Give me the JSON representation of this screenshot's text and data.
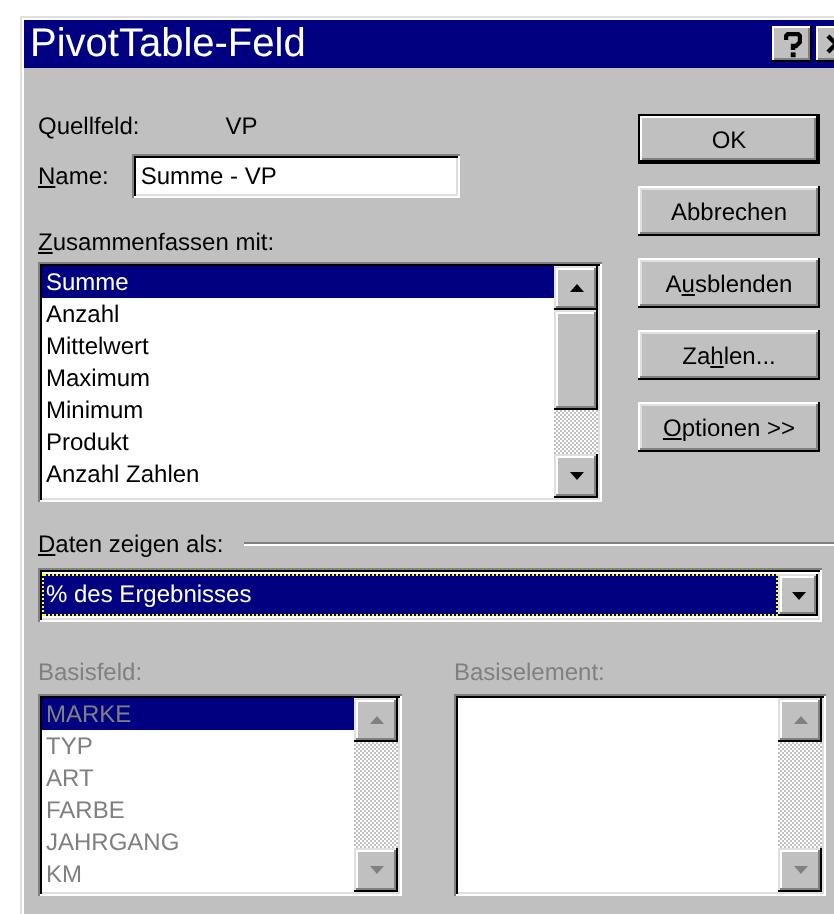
{
  "window": {
    "title": "PivotTable-Feld"
  },
  "source_field": {
    "label": "Quellfeld:",
    "value": "VP"
  },
  "name_field": {
    "label": {
      "key": "N",
      "post": "ame:"
    },
    "value": "Summe - VP"
  },
  "summarize": {
    "label": {
      "key": "Z",
      "post": "usammenfassen mit:"
    },
    "items": [
      {
        "text": "Summe",
        "selected": true
      },
      {
        "text": "Anzahl",
        "selected": false
      },
      {
        "text": "Mittelwert",
        "selected": false
      },
      {
        "text": "Maximum",
        "selected": false
      },
      {
        "text": "Minimum",
        "selected": false
      },
      {
        "text": "Produkt",
        "selected": false
      },
      {
        "text": "Anzahl Zahlen",
        "selected": false
      }
    ]
  },
  "buttons": [
    {
      "label": {
        "post": "OK"
      },
      "default": true
    },
    {
      "label": {
        "post": "Abbrechen"
      },
      "default": false
    },
    {
      "label": {
        "pre": "A",
        "key": "u",
        "post": "sblenden"
      },
      "default": false
    },
    {
      "label": {
        "pre": "Za",
        "key": "h",
        "post": "len..."
      },
      "default": false
    },
    {
      "label": {
        "key": "O",
        "post": "ptionen >>"
      },
      "default": false
    }
  ],
  "show_data_as": {
    "label": {
      "key": "D",
      "post": "aten zeigen als:"
    },
    "value": "% des Ergebnisses",
    "focused": true
  },
  "base_field": {
    "label": "Basisfeld:",
    "disabled": true,
    "items": [
      {
        "text": "MARKE",
        "selected": true
      },
      {
        "text": "TYP",
        "selected": false
      },
      {
        "text": "ART",
        "selected": false
      },
      {
        "text": "FARBE",
        "selected": false
      },
      {
        "text": "JAHRGANG",
        "selected": false
      },
      {
        "text": "KM",
        "selected": false
      }
    ]
  },
  "base_item": {
    "label": "Basiselement:",
    "disabled": true
  }
}
